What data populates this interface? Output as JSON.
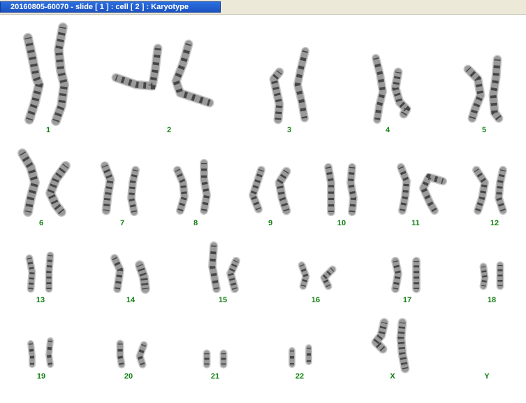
{
  "window": {
    "title": "20160805-60070 - slide [ 1 ] : cell [ 2 ] : Karyotype"
  },
  "karyotype": {
    "labels": [
      "1",
      "2",
      "3",
      "4",
      "5",
      "6",
      "7",
      "8",
      "9",
      "10",
      "11",
      "12",
      "13",
      "14",
      "15",
      "16",
      "17",
      "18",
      "19",
      "20",
      "21",
      "22",
      "X",
      "Y"
    ]
  },
  "colors": {
    "label_color": "#128012",
    "title_tab": "#1d52c0",
    "chromosome_band": "#2a2a2a",
    "chromosome_body": "#9a9a9a"
  }
}
